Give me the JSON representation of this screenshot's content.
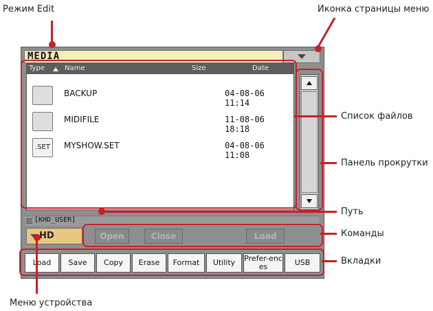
{
  "annotations": {
    "edit_mode": "Режим Edit",
    "menu_icon": "Иконка страницы меню",
    "file_list": "Список файлов",
    "scroll_bar": "Панель прокрутки",
    "path": "Путь",
    "commands": "Команды",
    "tabs": "Вкладки",
    "device_menu": "Меню устройства"
  },
  "window": {
    "title": "MEDIA",
    "menu_icon": "chevron-down-icon"
  },
  "file_list": {
    "columns": [
      "Type",
      "Name",
      "Size",
      "Date"
    ],
    "sort_icon": "sort-up-icon",
    "files": [
      {
        "icon": "folder",
        "name": "BACKUP",
        "date": "04-08-06 11:14"
      },
      {
        "icon": "folder",
        "name": "MIDIFILE",
        "date": "11-08-06 18:18"
      },
      {
        "icon": ".SET",
        "name": "MYSHOW.SET",
        "date": "04-08-06 11:08"
      }
    ]
  },
  "path": "[KHD_USER]",
  "device": {
    "label": "HD"
  },
  "commands": {
    "open": "Open",
    "close": "Close",
    "load": "Load"
  },
  "tabs": [
    "Load",
    "Save",
    "Copy",
    "Erase",
    "Format",
    "Utility",
    "Prefer-ences",
    "USB"
  ],
  "colors": {
    "annotation": "#c81f28",
    "title_bar": "#f3efbd",
    "device_button": "#e8c783"
  }
}
